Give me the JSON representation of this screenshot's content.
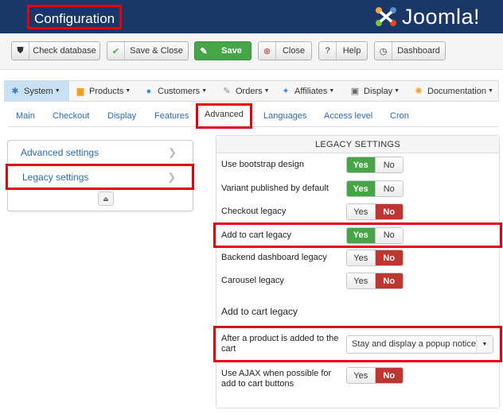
{
  "header": {
    "title": "Configuration",
    "brand": "Joomla!",
    "brand_color": "#1a3867"
  },
  "toolbar": {
    "check_db": "Check database",
    "save_close": "Save & Close",
    "save": "Save",
    "close": "Close",
    "help": "Help",
    "dashboard": "Dashboard"
  },
  "menu": {
    "items": [
      {
        "label": "System",
        "icon": "wrench-icon"
      },
      {
        "label": "Products",
        "icon": "products-icon"
      },
      {
        "label": "Customers",
        "icon": "customers-icon"
      },
      {
        "label": "Orders",
        "icon": "orders-icon"
      },
      {
        "label": "Affiliates",
        "icon": "affiliates-icon"
      },
      {
        "label": "Display",
        "icon": "display-icon"
      },
      {
        "label": "Documentation",
        "icon": "documentation-icon"
      }
    ]
  },
  "tabs": {
    "items": [
      "Main",
      "Checkout",
      "Display",
      "Features",
      "Advanced",
      "Languages",
      "Access level",
      "Cron"
    ],
    "active": "Advanced"
  },
  "sidenav": {
    "items": [
      "Advanced settings",
      "Legacy settings"
    ]
  },
  "panel": {
    "title": "LEGACY SETTINGS",
    "yes": "Yes",
    "no": "No",
    "rows": [
      {
        "label": "Use bootstrap design",
        "value": "Yes"
      },
      {
        "label": "Variant published by default",
        "value": "Yes"
      },
      {
        "label": "Checkout legacy",
        "value": "No"
      },
      {
        "label": "Add to cart legacy",
        "value": "Yes"
      },
      {
        "label": "Backend dashboard legacy",
        "value": "No"
      },
      {
        "label": "Carousel legacy",
        "value": "No"
      }
    ],
    "section_title": "Add to cart legacy",
    "after_add_label": "After a product is added to the cart",
    "after_add_value": "Stay and display a popup notice",
    "ajax_label": "Use AJAX when possible for add to cart buttons",
    "ajax_value": "No"
  },
  "colors": {
    "highlight": "#e0000d",
    "yes_on": "#46a546",
    "no_on": "#bd362f",
    "link": "#2a6bb1"
  }
}
